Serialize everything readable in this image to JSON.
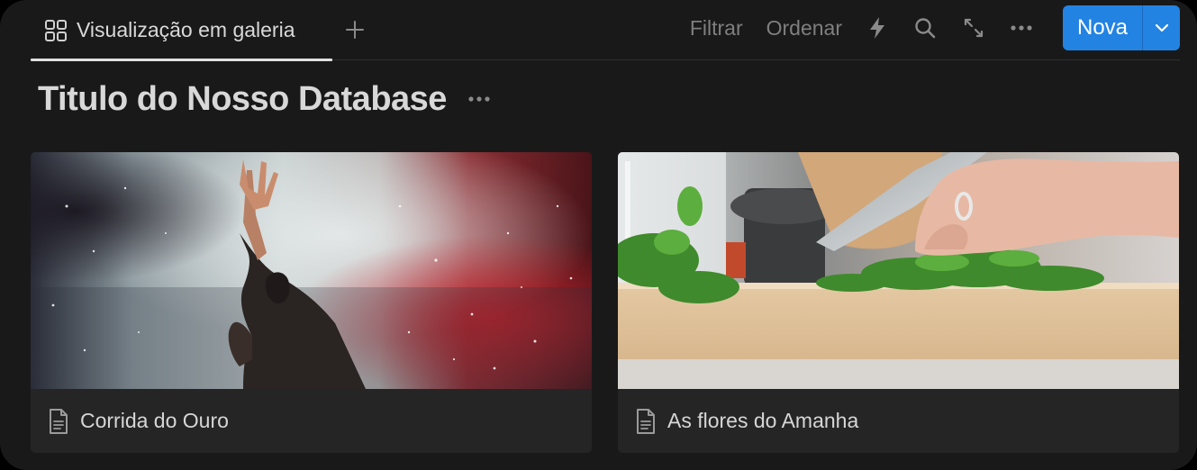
{
  "toolbar": {
    "view_tab_label": "Visualização em galeria",
    "add_view_icon": "plus-icon",
    "filter_label": "Filtrar",
    "sort_label": "Ordenar",
    "automation_icon": "lightning-icon",
    "search_icon": "search-icon",
    "expand_icon": "expand-icon",
    "more_icon": "more-horizontal-icon",
    "new_label": "Nova",
    "new_dropdown_icon": "chevron-down-icon"
  },
  "database": {
    "title": "Titulo do Nosso Database",
    "more_icon": "more-horizontal-icon"
  },
  "cards": [
    {
      "title": "Corrida do Ouro",
      "icon": "page-icon",
      "cover": "concert-performer-with-raised-hand-in-smoke"
    },
    {
      "title": "As flores do Amanha",
      "icon": "page-icon",
      "cover": "knife-chopping-herbs-on-cutting-board"
    }
  ],
  "colors": {
    "background": "#191919",
    "card": "#252525",
    "accent": "#2383e2",
    "muted_text": "#7f7f7f"
  }
}
